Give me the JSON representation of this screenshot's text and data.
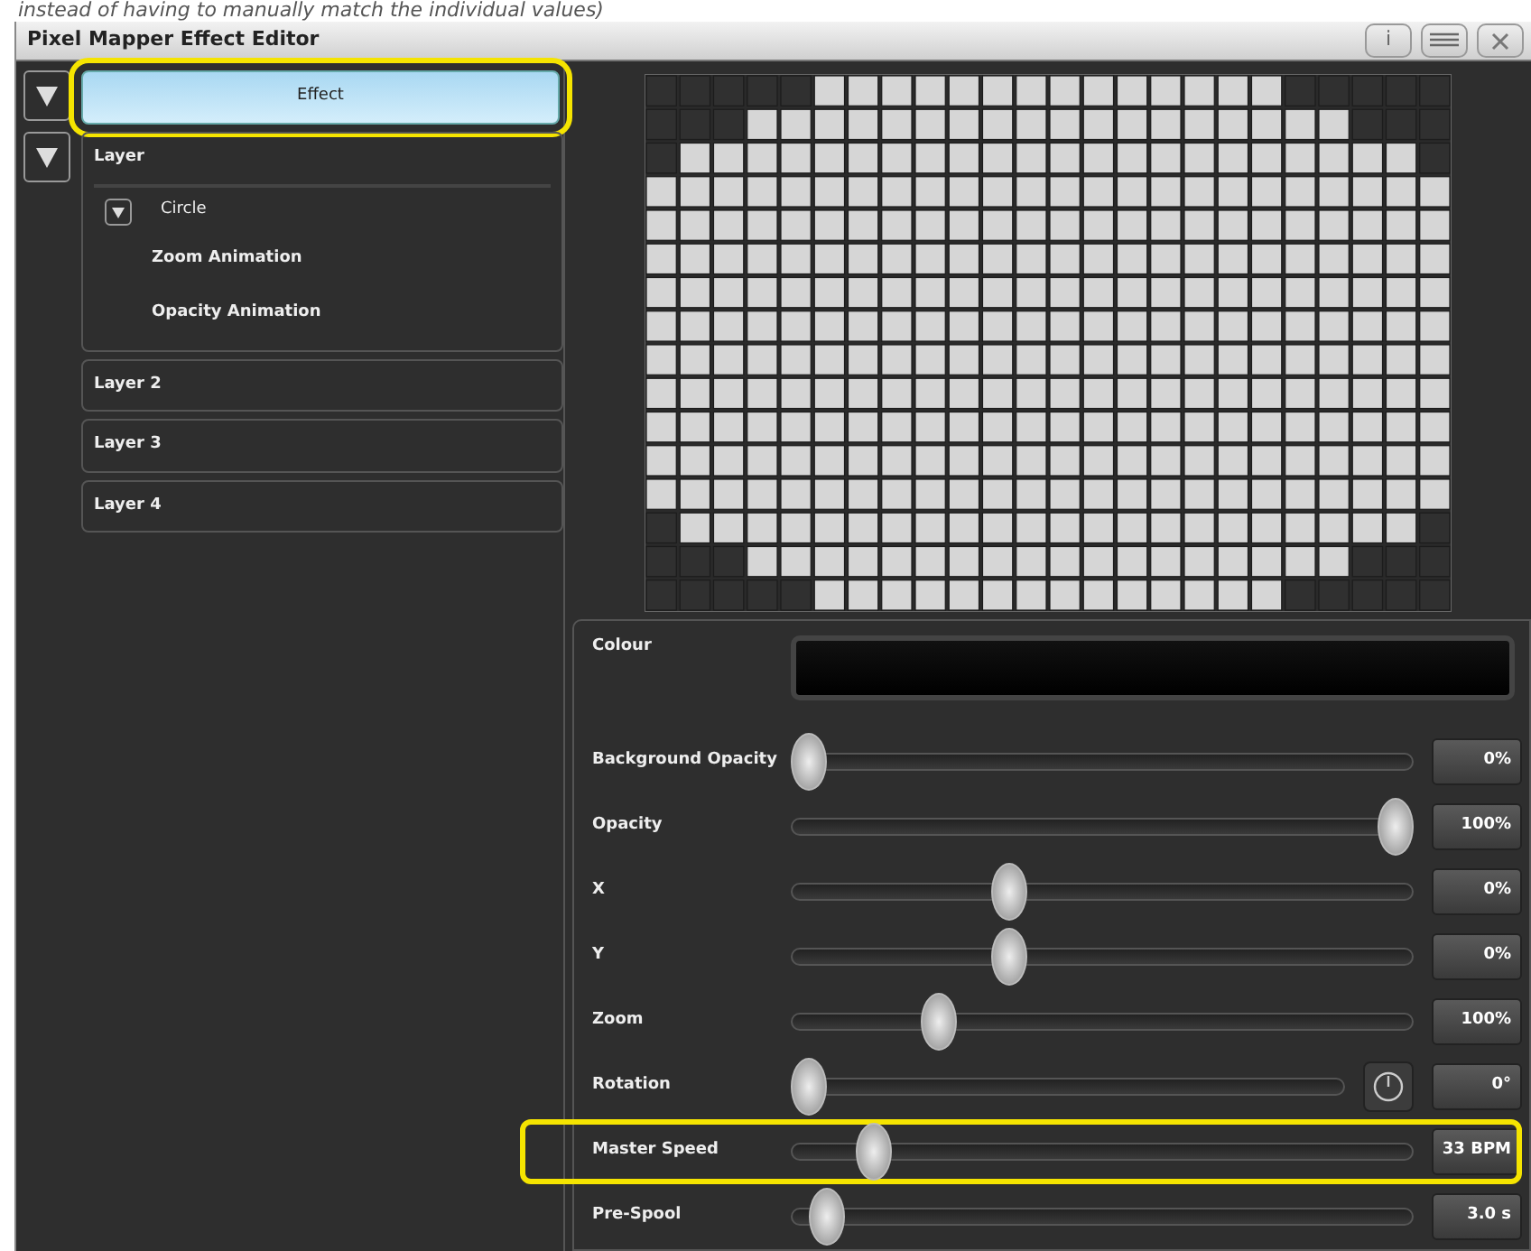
{
  "caption_fragment": "instead of having to manually match the individual values)",
  "window": {
    "title": "Pixel Mapper Effect Editor",
    "title_buttons": [
      {
        "kind": "info",
        "label": "i"
      },
      {
        "kind": "menu"
      },
      {
        "kind": "close"
      }
    ]
  },
  "effect": {
    "label": "Effect",
    "expanded": true,
    "selected": true,
    "highlighted": true
  },
  "layers": [
    {
      "label": "Layer",
      "expanded": true,
      "children": [
        {
          "label": "Circle",
          "expanded": true,
          "children": [
            {
              "label": "Zoom Animation"
            },
            {
              "label": "Opacity Animation"
            }
          ]
        }
      ]
    },
    {
      "label": "Layer 2"
    },
    {
      "label": "Layer 3"
    },
    {
      "label": "Layer 4"
    }
  ],
  "properties": [
    {
      "kind": "colour",
      "label": "Colour"
    },
    {
      "kind": "slider",
      "label": "Background Opacity",
      "level": 0.0,
      "reading": "0%",
      "highlighted": false
    },
    {
      "kind": "slider",
      "label": "Opacity",
      "level": 1.0,
      "reading": "100%",
      "highlighted": false
    },
    {
      "kind": "slider",
      "label": "X",
      "level": 0.34,
      "reading": "0%",
      "highlighted": false
    },
    {
      "kind": "slider",
      "label": "Y",
      "level": 0.34,
      "reading": "0%",
      "highlighted": false
    },
    {
      "kind": "slider",
      "label": "Zoom",
      "level": 0.22,
      "reading": "100%",
      "highlighted": false
    },
    {
      "kind": "dial",
      "label": "Rotation",
      "level": 0.0,
      "reading": "0°",
      "highlighted": false
    },
    {
      "kind": "slider",
      "label": "Master Speed",
      "level": 0.11,
      "reading": "33 BPM",
      "highlighted": true
    },
    {
      "kind": "slider",
      "label": "Pre-Spool",
      "level": 0.03,
      "reading": "3.0 s",
      "highlighted": false
    }
  ]
}
